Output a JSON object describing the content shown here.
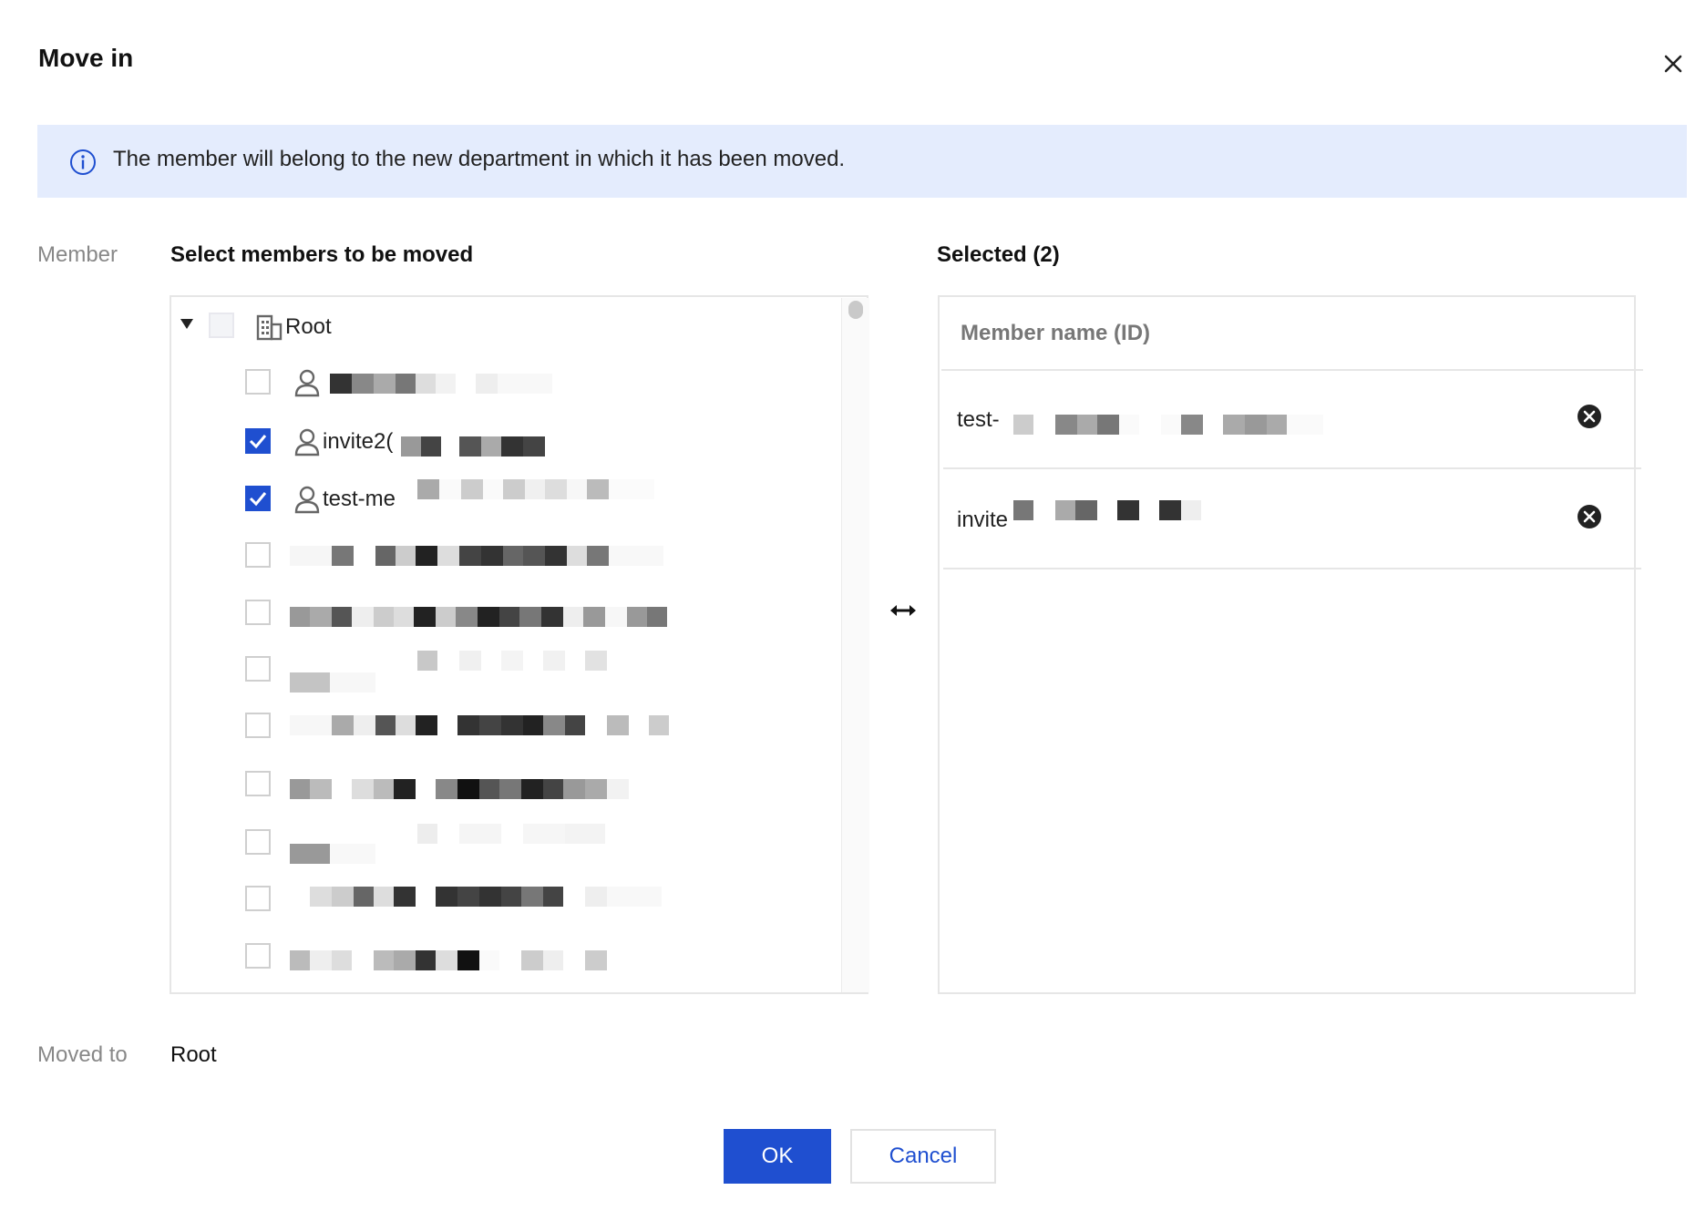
{
  "dialog": {
    "title": "Move in",
    "close_icon": "close-icon"
  },
  "alert": {
    "icon": "info-icon",
    "text": "The member will belong to the new department in which it has been moved."
  },
  "member_section": {
    "label": "Member",
    "heading": "Select members to be moved",
    "tree": {
      "root_label": "Root",
      "root_icon": "building-icon",
      "expand_icon": "caret-down-icon",
      "items": [
        {
          "name": "",
          "checked": false,
          "has_icon": true
        },
        {
          "name": "invite2(",
          "checked": true,
          "has_icon": true
        },
        {
          "name": "test-me",
          "checked": true,
          "has_icon": true
        },
        {
          "name": "",
          "checked": false,
          "has_icon": false
        },
        {
          "name": "",
          "checked": false,
          "has_icon": false
        },
        {
          "name": "",
          "checked": false,
          "has_icon": false
        },
        {
          "name": "",
          "checked": false,
          "has_icon": false
        },
        {
          "name": "",
          "checked": false,
          "has_icon": false
        },
        {
          "name": "",
          "checked": false,
          "has_icon": false
        },
        {
          "name": "",
          "checked": false,
          "has_icon": false
        },
        {
          "name": "",
          "checked": false,
          "has_icon": false
        }
      ]
    }
  },
  "transfer_icon": "swap-arrows-icon",
  "selected_section": {
    "heading": "Selected (2)",
    "column_header": "Member name (ID)",
    "items": [
      {
        "name": "test-",
        "remove_icon": "remove-circle-icon"
      },
      {
        "name": "invite",
        "remove_icon": "remove-circle-icon"
      }
    ]
  },
  "moved_to": {
    "label": "Moved to",
    "value": "Root"
  },
  "buttons": {
    "ok": "OK",
    "cancel": "Cancel"
  },
  "colors": {
    "primary": "#1f4fd0",
    "alert_bg": "#e4ecfd"
  }
}
